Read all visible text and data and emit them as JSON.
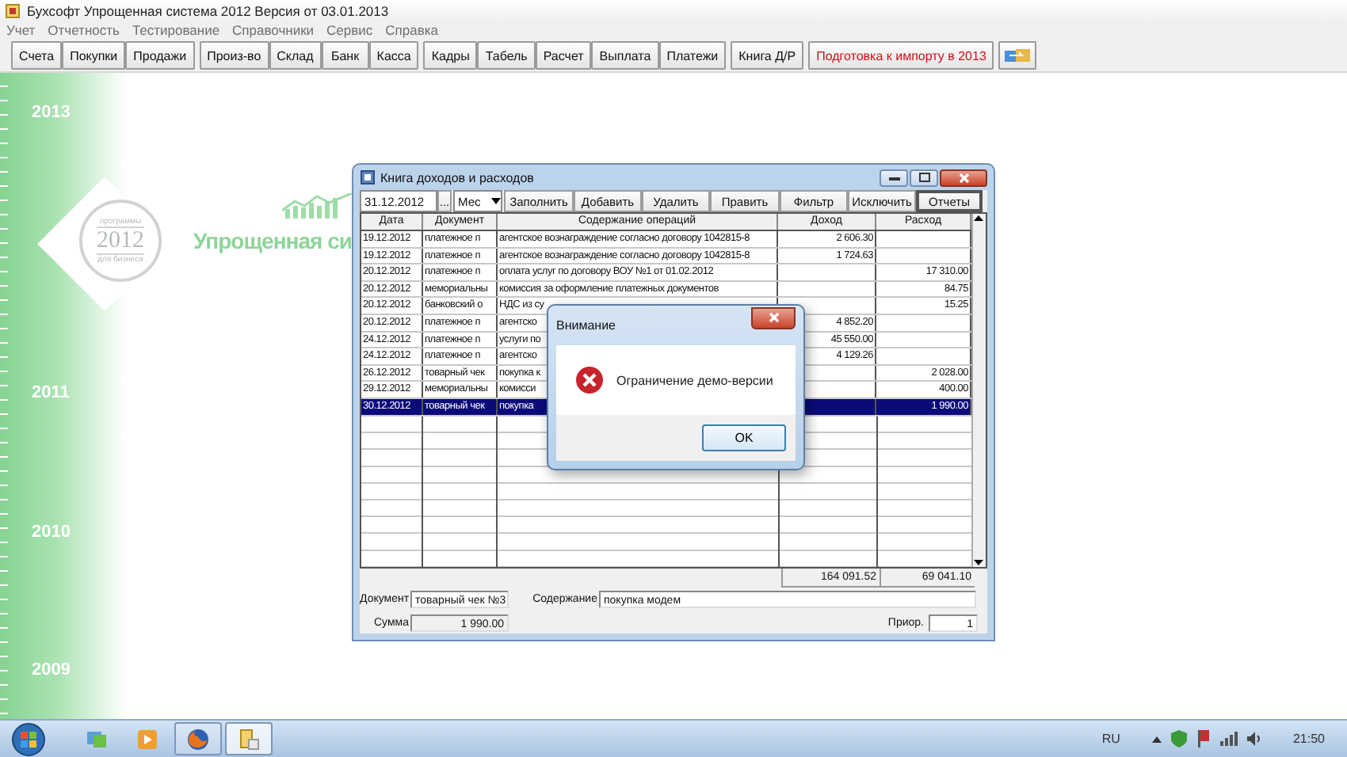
{
  "app": {
    "title": "Бухсофт Упрощенная система 2012 Версия от 03.01.2013",
    "menu": [
      "Учет",
      "Отчетность",
      "Тестирование",
      "Справочники",
      "Сервис",
      "Справка"
    ],
    "toolbar_groups": [
      [
        {
          "label": "Счета",
          "kind": "text"
        },
        {
          "label": "Покупки",
          "kind": "text"
        },
        {
          "label": "Продажи",
          "kind": "text"
        }
      ],
      [
        {
          "label": "Произ-во",
          "kind": "text"
        },
        {
          "label": "Склад",
          "kind": "text"
        },
        {
          "label": "Банк",
          "kind": "text"
        },
        {
          "label": "Касса",
          "kind": "text"
        }
      ],
      [
        {
          "label": "Кадры",
          "kind": "text"
        },
        {
          "label": "Табель",
          "kind": "text"
        },
        {
          "label": "Расчет",
          "kind": "text"
        },
        {
          "label": "Выплата",
          "kind": "text"
        },
        {
          "label": "Платежи",
          "kind": "text"
        }
      ],
      [
        {
          "label": "Книга Д/Р",
          "kind": "text"
        }
      ],
      [
        {
          "label": "Подготовка к импорту в 2013",
          "kind": "highlight"
        }
      ],
      [
        {
          "kind": "icon"
        }
      ]
    ]
  },
  "background": {
    "years": [
      "2013",
      "2011",
      "2010",
      "2009"
    ],
    "stamp": {
      "top": "программы",
      "year": "2012",
      "bottom": "для бизнеса"
    },
    "slogan": "Упрощенная си"
  },
  "ledger": {
    "title": "Книга доходов и расходов",
    "date": "31.12.2012",
    "picker": "...",
    "period": "Мес",
    "buttons": [
      {
        "label": "Заполнить",
        "default": false
      },
      {
        "label": "Добавить",
        "default": false
      },
      {
        "label": "Удалить",
        "default": false
      },
      {
        "label": "Править",
        "default": false
      },
      {
        "label": "Фильтр",
        "default": false
      },
      {
        "label": "Исключить",
        "default": false
      },
      {
        "label": "Отчеты",
        "default": true
      }
    ],
    "columns": [
      "Дата",
      "Документ",
      "Содержание операций",
      "Доход",
      "Расход"
    ],
    "rows": [
      {
        "date": "19.12.2012",
        "document": "платежное п",
        "content": "агентское вознаграждение согласно договору 1042815-8",
        "income": "2 606.30",
        "selected": false
      },
      {
        "date": "19.12.2012",
        "document": "платежное п",
        "content": "агентское вознаграждение согласно договору 1042815-8",
        "income": "1 724.63",
        "selected": false
      },
      {
        "date": "20.12.2012",
        "document": "платежное п",
        "content": "оплата услуг по договору ВОУ №1 от 01.02.2012",
        "expense": "17 310.00",
        "selected": false
      },
      {
        "date": "20.12.2012",
        "document": "мемориальны",
        "content": "комиссия за оформление платежных документов",
        "expense": "84.75",
        "selected": false
      },
      {
        "date": "20.12.2012",
        "document": "банковский о",
        "content": "НДС из су",
        "expense": "15.25",
        "selected": false
      },
      {
        "date": "20.12.2012",
        "document": "платежное п",
        "content": "агентско",
        "income": "4 852.20",
        "selected": false
      },
      {
        "date": "24.12.2012",
        "document": "платежное п",
        "content": "услуги по",
        "income": "45 550.00",
        "selected": false
      },
      {
        "date": "24.12.2012",
        "document": "платежное п",
        "content": "агентско",
        "income": "4 129.26",
        "selected": false
      },
      {
        "date": "26.12.2012",
        "document": "товарный чек",
        "content": "покупка к",
        "expense": "2 028.00",
        "selected": false
      },
      {
        "date": "29.12.2012",
        "document": "мемориальны",
        "content": "комисси",
        "expense": "400.00",
        "selected": false
      },
      {
        "date": "30.12.2012",
        "document": "товарный чек",
        "content": "покупка",
        "expense": "1 990.00",
        "selected": true
      }
    ],
    "totals": {
      "income": "164 091.52",
      "expense": "69 041.10"
    },
    "fields": {
      "document_label": "Документ",
      "document": "товарный чек №3",
      "content_label": "Содержание",
      "content": "покупка  модем",
      "sum_label": "Сумма",
      "sum": "1 990.00",
      "priority_label": "Приор.",
      "priority": "1"
    }
  },
  "dialog": {
    "title": "Внимание",
    "message": "Ограничение демо-версии",
    "button": "OK"
  },
  "taskbar": {
    "apps": [
      {
        "kind": "folder",
        "running": false,
        "selected": false
      },
      {
        "kind": "media",
        "running": false,
        "selected": false
      },
      {
        "kind": "browser",
        "running": true,
        "selected": false
      },
      {
        "kind": "app",
        "running": true,
        "selected": true
      }
    ],
    "language": "RU",
    "clock": "21:50"
  }
}
